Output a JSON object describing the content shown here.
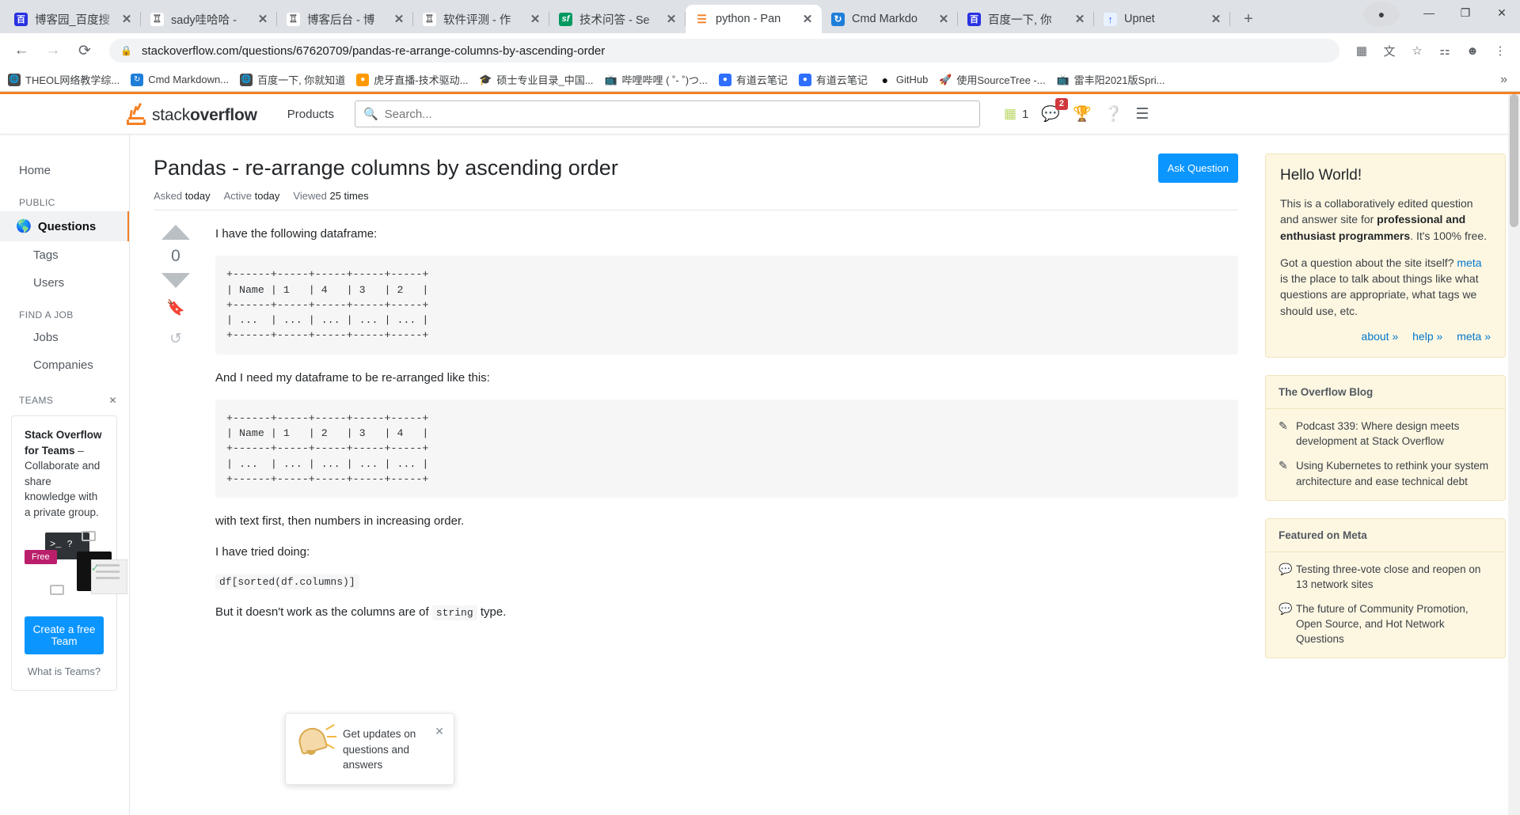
{
  "browser": {
    "tabs": [
      {
        "title": "博客园_百度搜",
        "fav": "baidu",
        "active": false
      },
      {
        "title": "sady哇哈哈 -",
        "fav": "zhihu",
        "active": false
      },
      {
        "title": "博客后台 - 博",
        "fav": "zhihu",
        "active": false
      },
      {
        "title": "软件评测 - 作",
        "fav": "zhihu",
        "active": false
      },
      {
        "title": "技术问答 - Se",
        "fav": "sf",
        "active": false
      },
      {
        "title": "python - Pan",
        "fav": "so",
        "active": true
      },
      {
        "title": "Cmd Markdo",
        "fav": "cmd",
        "active": false
      },
      {
        "title": "百度一下, 你",
        "fav": "baidu",
        "active": false
      },
      {
        "title": "Upnet",
        "fav": "upnet",
        "active": false
      }
    ],
    "new_tab_label": "+",
    "window_controls": {
      "minimize": "—",
      "maximize": "❐",
      "close": "✕"
    },
    "nav": {
      "back": "←",
      "forward": "→",
      "reload": "⟳"
    },
    "url": "stackoverflow.com/questions/67620709/pandas-re-arrange-columns-by-ascending-order",
    "lock_icon": "🔒",
    "toolbar_icons": [
      "qr-code-icon",
      "translate-icon",
      "bookmark-star-icon",
      "extensions-icon",
      "profile-icon",
      "menu-icon"
    ],
    "bookmarks": [
      {
        "label": "THEOL网络教学综...",
        "fav": "globe"
      },
      {
        "label": "Cmd Markdown...",
        "fav": "cmd"
      },
      {
        "label": "百度一下, 你就知道",
        "fav": "globe"
      },
      {
        "label": "虎牙直播-技术驱动...",
        "fav": "huya"
      },
      {
        "label": "硕士专业目录_中国...",
        "fav": "cap"
      },
      {
        "label": "哔哩哔哩 ( ˚- ˚)つ...",
        "fav": "bili"
      },
      {
        "label": "有道云笔记",
        "fav": "youdao"
      },
      {
        "label": "有道云笔记",
        "fav": "youdao"
      },
      {
        "label": "GitHub",
        "fav": "github"
      },
      {
        "label": "使用SourceTree -...",
        "fav": "rocket"
      },
      {
        "label": "雷丰阳2021版Spri...",
        "fav": "bili"
      }
    ],
    "bookmarks_overflow": "»"
  },
  "so": {
    "logo": {
      "text_light": "stack",
      "text_bold": "overflow"
    },
    "products_label": "Products",
    "search_placeholder": "Search...",
    "reputation": "1",
    "inbox_badge": "2",
    "header_icons": [
      "achievements-icon",
      "inbox-icon",
      "trophy-icon",
      "help-icon",
      "site-switcher-icon"
    ],
    "nav": {
      "home": "Home",
      "public_header": "PUBLIC",
      "questions": "Questions",
      "tags": "Tags",
      "users": "Users",
      "jobs_header": "FIND A JOB",
      "jobs": "Jobs",
      "companies": "Companies"
    },
    "teams": {
      "header": "TEAMS",
      "close": "✕",
      "blurb_bold_1": "Stack Overflow for Teams",
      "blurb_rest": " – Collaborate and share knowledge with a private group.",
      "free_badge": "Free",
      "cta": "Create a free Team",
      "link": "What is Teams?"
    },
    "question": {
      "title": "Pandas - re-arrange columns by ascending order",
      "ask_button": "Ask Question",
      "meta": [
        {
          "label": "Asked",
          "value": "today"
        },
        {
          "label": "Active",
          "value": "today"
        },
        {
          "label": "Viewed",
          "value": "25 times"
        }
      ],
      "vote_count": "0",
      "vote_up_icon": "upvote-arrow-icon",
      "vote_down_icon": "downvote-arrow-icon",
      "bookmark_icon": "bookmark-icon",
      "history_icon": "history-icon",
      "para1": "I have the following dataframe:",
      "code1_lines": [
        "+------+-----+-----+-----+-----+",
        "| Name | 1   | 4   | 3   | 2   |",
        "+------+-----+-----+-----+-----+",
        "| ...  | ... | ... | ... | ... |",
        "+------+-----+-----+-----+-----+"
      ],
      "para2": "And I need my dataframe to be re-arranged like this:",
      "code2_lines": [
        "+------+-----+-----+-----+-----+",
        "| Name | 1   | 2   | 3   | 4   |",
        "+------+-----+-----+-----+-----+",
        "| ...  | ... | ... | ... | ... |",
        "+------+-----+-----+-----+-----+"
      ],
      "para3": "with text first, then numbers in increasing order.",
      "para4": "I have tried doing:",
      "code3": "df[sorted(df.columns)]",
      "para5_a": "But it doesn't work as the columns are of ",
      "para5_code": "string",
      "para5_b": " type."
    },
    "sidebar": {
      "hello": {
        "title": "Hello World!",
        "p1_a": "This is a collaboratively edited question and answer site for ",
        "p1_bold": "professional and enthusiast programmers",
        "p1_b": ". It's 100% free.",
        "p2_a": "Got a question about the site itself? ",
        "p2_link": "meta",
        "p2_b": " is the place to talk about things like what questions are appropriate, what tags we should use, etc.",
        "links": [
          "about »",
          "help »",
          "meta »"
        ]
      },
      "blog": {
        "title": "The Overflow Blog",
        "items": [
          "Podcast 339: Where design meets development at Stack Overflow",
          "Using Kubernetes to rethink your system architecture and ease technical debt"
        ]
      },
      "meta": {
        "title": "Featured on Meta",
        "items": [
          "Testing three-vote close and reopen on 13 network sites",
          "The future of Community Promotion, Open Source, and Hot Network Questions"
        ]
      }
    },
    "toast": {
      "text": "Get updates on questions and answers",
      "close": "✕",
      "icon": "bell-notification-icon"
    }
  }
}
